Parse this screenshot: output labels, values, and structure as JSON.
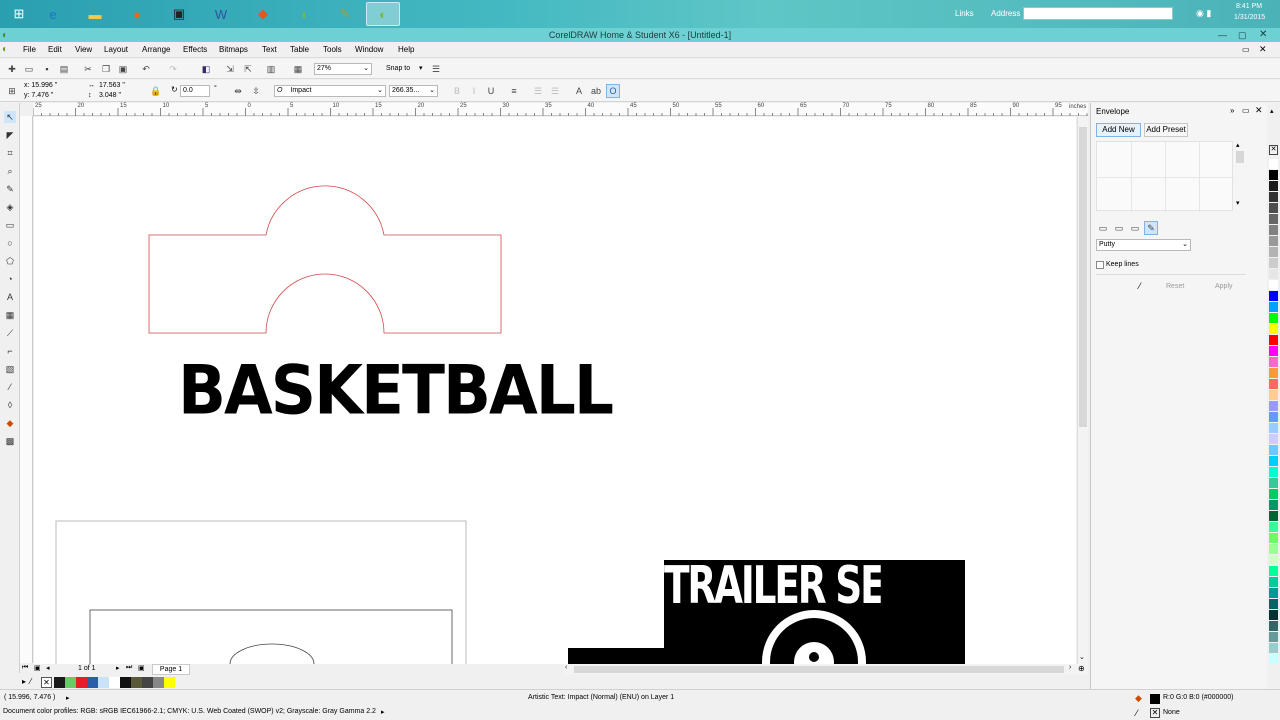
{
  "taskbar": {
    "apps": [
      "start-icon",
      "ie-icon",
      "folder-icon",
      "firefox-icon",
      "bitdefender-icon",
      "word-icon",
      "office-icon",
      "coreldraw-green-icon",
      "corel-pen-icon",
      "coreldraw-active-icon"
    ],
    "links_label": "Links",
    "address_label": "Address",
    "time": "8:41 PM",
    "date": "1/31/2015"
  },
  "window": {
    "title": "CorelDRAW Home & Student X6 - [Untitled-1]"
  },
  "menu": [
    "File",
    "Edit",
    "View",
    "Layout",
    "Arrange",
    "Effects",
    "Bitmaps",
    "Text",
    "Table",
    "Tools",
    "Window",
    "Help"
  ],
  "toolbar": {
    "zoom": "27%",
    "snap_to": "Snap to"
  },
  "property_bar": {
    "x": "x: 15.996 \"",
    "y": "y: 7.476 \"",
    "w": "17.563 \"",
    "h": "3.048 \"",
    "angle": "0.0",
    "degree": "°",
    "font_name": "Impact",
    "font_size": "266.35..."
  },
  "ruler": {
    "top_labels": [
      "25",
      "20",
      "15",
      "10",
      "5",
      "0",
      "5",
      "10",
      "15",
      "20",
      "25",
      "30",
      "35",
      "40",
      "45",
      "50",
      "55",
      "60",
      "65",
      "70",
      "75",
      "80",
      "85",
      "90",
      "95"
    ],
    "units": "inches"
  },
  "canvas": {
    "text1": "BASKETBALL",
    "text2": "TRAILER SERVICE"
  },
  "page_nav": {
    "page_count": "1 of 1",
    "page_tab": "Page 1"
  },
  "docker": {
    "title": "Envelope",
    "add_new": "Add New",
    "add_preset": "Add Preset",
    "mode": "Putty",
    "keep_lines": "Keep lines",
    "reset": "Reset",
    "apply": "Apply"
  },
  "status": {
    "coords": "( 15.996, 7.476 )",
    "object_info": "Artistic Text: Impact (Normal) (ENU) on Layer 1",
    "color_profiles": "Document color profiles: RGB: sRGB IEC61966-2.1; CMYK: U.S. Web Coated (SWOP) v2; Grayscale: Gray Gamma 2.2",
    "fill": "R:0 G:0 B:0 (#000000)",
    "outline": "None"
  },
  "colors": {
    "palette": [
      "#1a1a1a",
      "#66cc66",
      "#e31e24",
      "#2b5ea8",
      "#c9e2f5",
      "#ffffff",
      "#111111",
      "#5a5a3a",
      "#444444",
      "#888888",
      "#ffff00"
    ],
    "vertical_palette": [
      "#ffffff",
      "#000000",
      "#1a1a1a",
      "#333333",
      "#4d4d4d",
      "#666666",
      "#808080",
      "#999999",
      "#b3b3b3",
      "#cccccc",
      "#e6e6e6",
      "#ffffff",
      "#0000ff",
      "#00a0ff",
      "#00ff00",
      "#ffff00",
      "#ff0000",
      "#ff00ff",
      "#ff66cc",
      "#ff9933",
      "#ff6666",
      "#ffcc99",
      "#9999ff",
      "#6699ff",
      "#99ccff",
      "#ccccff",
      "#66ccff",
      "#00ccff",
      "#00ffcc",
      "#33cc99",
      "#00cc66",
      "#009966",
      "#006633",
      "#33ff99",
      "#66ff66",
      "#99ff99",
      "#ccffcc",
      "#00ff99",
      "#00cc99",
      "#009999",
      "#006666",
      "#003333",
      "#336666",
      "#669999",
      "#99cccc",
      "#ccffff"
    ]
  }
}
